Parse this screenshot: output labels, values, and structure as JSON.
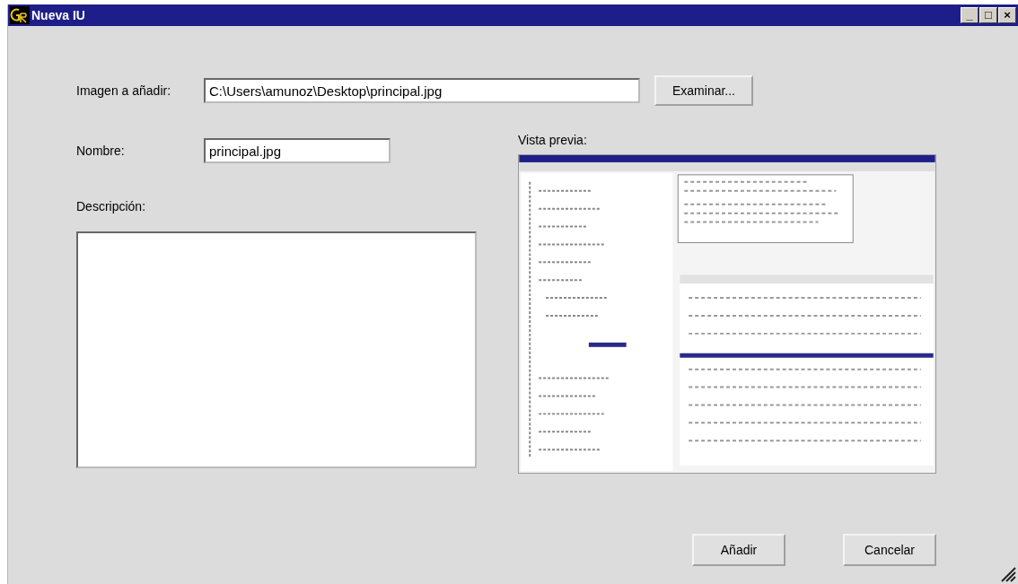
{
  "window": {
    "title": "Nueva IU",
    "controls": [
      "_",
      "□",
      "×"
    ]
  },
  "image_field": {
    "label": "Imagen a añadir:",
    "value": "C:\\Users\\amunoz\\Desktop\\principal.jpg"
  },
  "browse_button": "Examinar...",
  "name_field": {
    "label": "Nombre:",
    "value": "principal.jpg"
  },
  "description_field": {
    "label": "Descripción:"
  },
  "preview": {
    "label": "Vista previa:",
    "kind": "picture"
  },
  "buttons": [
    "Añadir",
    "Cancelar"
  ]
}
